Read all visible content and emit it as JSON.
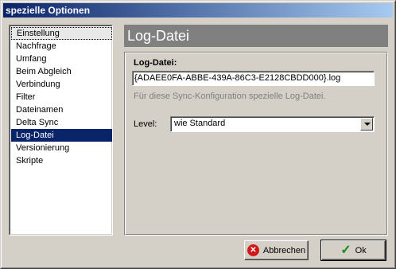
{
  "window": {
    "title": "spezielle Optionen"
  },
  "sidebar": {
    "items": [
      {
        "label": "Einstellung"
      },
      {
        "label": "Nachfrage"
      },
      {
        "label": "Umfang"
      },
      {
        "label": "Beim Abgleich"
      },
      {
        "label": "Verbindung"
      },
      {
        "label": "Filter"
      },
      {
        "label": "Dateinamen"
      },
      {
        "label": "Delta Sync"
      },
      {
        "label": "Log-Datei"
      },
      {
        "label": "Versionierung"
      },
      {
        "label": "Skripte"
      }
    ],
    "selected_index": 8
  },
  "panel": {
    "title": "Log-Datei",
    "logfile_label": "Log-Datei:",
    "logfile_value": "{ADAEE0FA-ABBE-439A-86C3-E2128CBDD000}.log",
    "hint": "Für diese Sync-Konfiguration spezielle Log-Datei.",
    "level_label": "Level:",
    "level_value": "wie Standard"
  },
  "buttons": {
    "cancel_label": "Abbrechen",
    "ok_label": "Ok"
  },
  "colors": {
    "selection": "#0a246a",
    "header_bg": "#808080",
    "face": "#d4d0c8"
  }
}
